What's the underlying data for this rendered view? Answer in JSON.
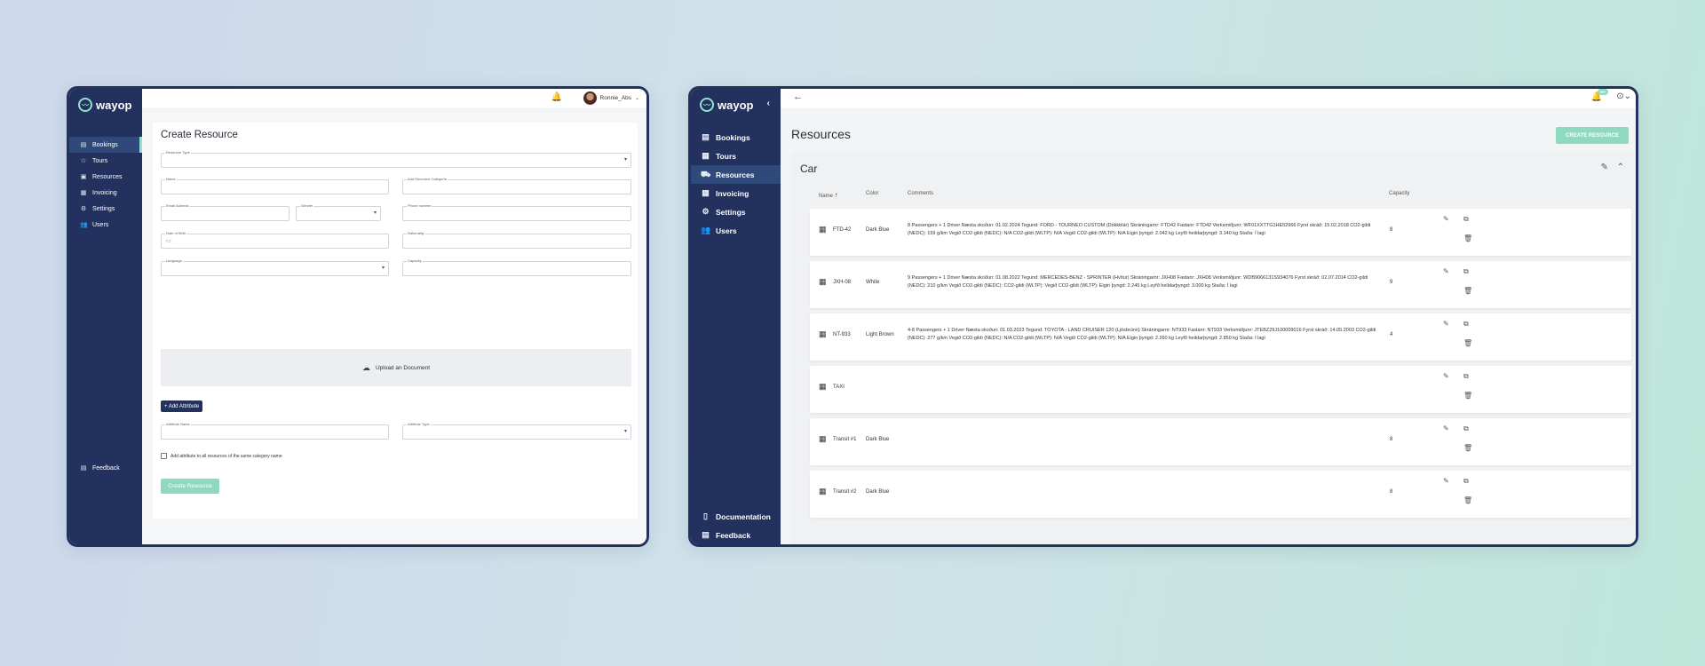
{
  "brand": "wayop",
  "create_window": {
    "nav": [
      {
        "label": "Bookings",
        "icon": "bookings-icon",
        "active": true
      },
      {
        "label": "Tours",
        "icon": "star-icon"
      },
      {
        "label": "Resources",
        "icon": "resources-icon"
      },
      {
        "label": "Invoicing",
        "icon": "invoice-icon"
      },
      {
        "label": "Settings",
        "icon": "gear-icon"
      },
      {
        "label": "Users",
        "icon": "users-icon"
      }
    ],
    "feedback": "Feedback",
    "user_name": "Ronnie_Abs",
    "title": "Create Resource",
    "fields": {
      "resource_type": "Resource Type",
      "name": "Name",
      "add_category": "Add Resource Categorie",
      "email": "Email Address",
      "gender": "Gender",
      "phone": "Phone number",
      "dob": "Date of Birth",
      "nationality": "Nationality",
      "language": "Language",
      "capacity": "Capacity",
      "attribute_name": "Attribute Name",
      "attribute_type": "Attribute Type"
    },
    "upload_label": "Upload an Document",
    "add_attribute": "+ Add Attribute",
    "checkbox_label": "Add attribute to all resources of the same category name",
    "create_button": "Create Resource"
  },
  "resources_window": {
    "nav": [
      {
        "label": "Bookings",
        "icon": "bookings-icon"
      },
      {
        "label": "Tours",
        "icon": "calendar-icon"
      },
      {
        "label": "Resources",
        "icon": "car-icon",
        "active": true
      },
      {
        "label": "Invoicing",
        "icon": "invoice-icon"
      },
      {
        "label": "Settings",
        "icon": "gear-icon"
      },
      {
        "label": "Users",
        "icon": "users-icon"
      }
    ],
    "documentation": "Documentation",
    "feedback": "Feedback",
    "notif_badge": "99+",
    "page_title": "Resources",
    "create_button": "CREATE RESOURCE",
    "section_title": "Car",
    "columns": {
      "name": "Name",
      "color": "Color",
      "comments": "Comments",
      "capacity": "Capacity"
    },
    "rows": [
      {
        "name": "FTD-42",
        "color": "Dark Blue",
        "comments": "8 Passengers + 1 Driver Næsta skoðun: 01.02.2024 Tegund: FORD - TOURNEO CUSTOM (Dökkblár) Skráningarnr: FTD42 Fastanr: FTD42 Verksmiðjunr: WF01XXTTG1HE52966 Fyrst skráð: 15.02.2018 CO2-gildi (NEDC): 159 g/km Vegið CO2-gildi (NEDC): N/A CO2-gildi (WLTP): N/A Vegið CO2-gildi (WLTP): N/A Eigin þyngd: 2.042 kg Leyfð heildarþyngd: 3.140 kg Staða: Í lagi",
        "capacity": "8"
      },
      {
        "name": "JXH-08",
        "color": "White",
        "comments": "9 Passengers + 1 Driver Næsta skoðun: 01.08.2022 Tegund: MERCEDES-BENZ - SPRINTER (Hvítur) Skráningarnr: JXH08 Fastanr: JXH08 Verksmiðjunr: WDB9066131S934076 Fyrst skráð: 02.07.2014 CO2-gildi (NEDC): 210 g/km Vegið CO2-gildi (NEDC): CO2-gildi (WLTP): Vegið CO2-gildi (WLTP): Eigin þyngd: 2.245 kg Leyfð heildarþyngd: 3.000 kg Staða: Í lagi",
        "capacity": "9"
      },
      {
        "name": "NT-933",
        "color": "Light Brown",
        "comments": "4-8 Passengers + 1 Driver Næsta skoðun: 01.03.2023 Tegund: TOYOTA - LAND CRUISER 120 (Ljósbrúnn) Skráningarnr: NT933 Fastanr: NT933 Verksmiðjunr: JTEBZ29J100009016 Fyrst skráð: 14.05.2003 CO2-gildi (NEDC): 277 g/km Vegið CO2-gildi (NEDC): N/A CO2-gildi (WLTP): N/A Vegið CO2-gildi (WLTP): N/A Eigin þyngd: 2.260 kg Leyfð heildarþyngd: 2.850 kg Staða: Í lagi",
        "capacity": "4"
      },
      {
        "name": "TAXI",
        "color": "",
        "comments": "",
        "capacity": ""
      },
      {
        "name": "Transit #1",
        "color": "Dark Blue",
        "comments": "",
        "capacity": "8"
      },
      {
        "name": "Transit #2",
        "color": "Dark Blue",
        "comments": "",
        "capacity": "8"
      }
    ]
  },
  "colors": {
    "sidebar": "#23315f",
    "accent": "#8fe3c9"
  }
}
